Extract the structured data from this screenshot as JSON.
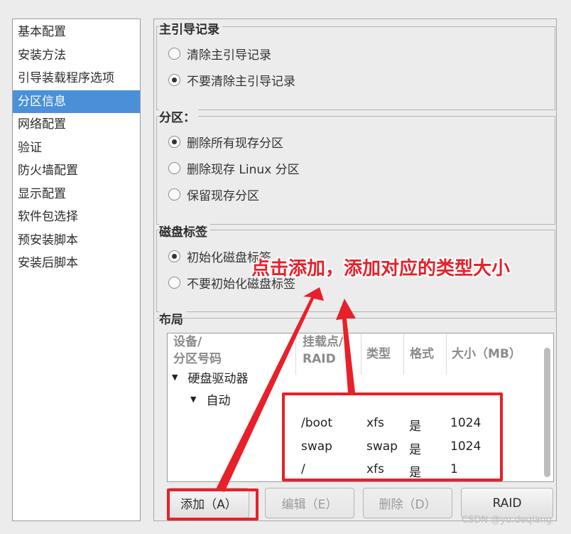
{
  "sidebar": {
    "items": [
      {
        "label": "基本配置"
      },
      {
        "label": "安装方法"
      },
      {
        "label": "引导装载程序选项"
      },
      {
        "label": "分区信息",
        "selected": true
      },
      {
        "label": "网络配置"
      },
      {
        "label": "验证"
      },
      {
        "label": "防火墙配置"
      },
      {
        "label": "显示配置"
      },
      {
        "label": "软件包选择"
      },
      {
        "label": "预安装脚本"
      },
      {
        "label": "安装后脚本"
      }
    ]
  },
  "mbr": {
    "title": "主引导记录",
    "options": [
      {
        "label": "清除主引导记录",
        "checked": false
      },
      {
        "label": "不要清除主引导记录",
        "checked": true
      }
    ]
  },
  "partitions": {
    "title": "分区：",
    "options": [
      {
        "label": "删除所有现存分区",
        "checked": true
      },
      {
        "label": "删除现存 Linux 分区",
        "checked": false
      },
      {
        "label": "保留现存分区",
        "checked": false
      }
    ]
  },
  "disk_label": {
    "title": "磁盘标签",
    "options": [
      {
        "label": "初始化磁盘标签",
        "checked": true
      },
      {
        "label": "不要初始化磁盘标签",
        "checked": false
      }
    ]
  },
  "layout": {
    "title": "布局",
    "columns": {
      "device_line1": "设备/",
      "device_line2": "分区号码",
      "mount_line1": "挂载点/",
      "mount_line2": "RAID",
      "type": "类型",
      "format": "格式",
      "size": "大小（MB）"
    },
    "tree": {
      "hard_drives": "硬盘驱动器",
      "auto": "自动"
    },
    "rows": [
      {
        "mount": "/boot",
        "type": "xfs",
        "format": "是",
        "size": "1024"
      },
      {
        "mount": "swap",
        "type": "swap",
        "format": "是",
        "size": "1024"
      },
      {
        "mount": "/",
        "type": "xfs",
        "format": "是",
        "size": "1"
      }
    ]
  },
  "buttons": {
    "add": "添加（A）",
    "edit": "编辑（E）",
    "delete": "删除（D）",
    "raid": "RAID"
  },
  "annotation": {
    "text": "点击添加，添加对应的类型大小",
    "color": "#e8202a"
  },
  "watermark": "CSDN @yu.deqiang"
}
